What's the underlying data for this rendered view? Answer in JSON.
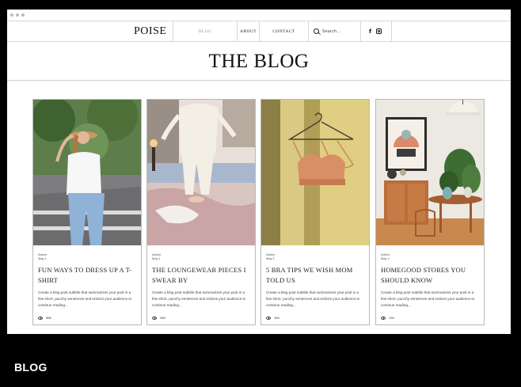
{
  "site": {
    "logo": "POISE",
    "nav": [
      "BLOG",
      "ABOUT",
      "CONTACT"
    ],
    "search_placeholder": "Search...",
    "social_icons": [
      "facebook-icon",
      "instagram-icon"
    ]
  },
  "page": {
    "title": "THE BLOG",
    "footer_label": "BLOG"
  },
  "posts": [
    {
      "author": "Admin",
      "date": "May 1",
      "title": "FUN WAYS TO DRESS UP A T-SHIRT",
      "excerpt": "Create a blog post subtitle that summarizes your post in a few short, punchy sentences and entices your audience to continue reading...",
      "views": "858",
      "image": "woman-in-white-tshirt-and-hat"
    },
    {
      "author": "Admin",
      "date": "May 1",
      "title": "THE LOUNGEWEAR PIECES I SWEAR BY",
      "excerpt": "Create a blog post subtitle that summarizes your post in a few short, punchy sentences and entices your audience to continue reading...",
      "views": "456",
      "image": "person-standing-on-bed-in-loungewear"
    },
    {
      "author": "Admin",
      "date": "May 1",
      "title": "5 BRA TIPS WE WISH MOM TOLD US",
      "excerpt": "Create a blog post subtitle that summarizes your post in a few short, punchy sentences and entices your audience to continue reading...",
      "views": "155",
      "image": "bra-on-hanger-yellow-wall"
    },
    {
      "author": "Admin",
      "date": "May 1",
      "title": "HOMEGOOD STORES YOU SHOULD KNOW",
      "excerpt": "Create a blog post subtitle that summarizes your post in a few short, punchy sentences and entices your audience to continue reading...",
      "views": "126",
      "image": "interior-with-lamp-and-plant"
    }
  ]
}
